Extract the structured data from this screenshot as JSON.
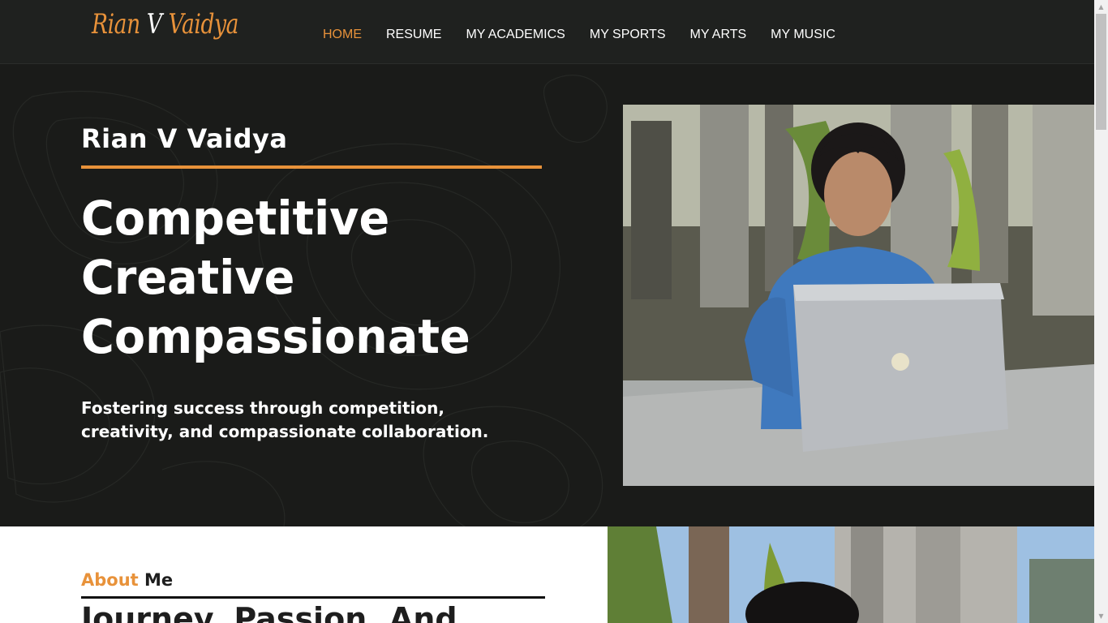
{
  "brand": {
    "logo_first": "Rian",
    "logo_middle": "V",
    "logo_last": "Vaidya",
    "accent_color": "#e8923a"
  },
  "nav": {
    "items": [
      {
        "label": "HOME",
        "active": true
      },
      {
        "label": "RESUME"
      },
      {
        "label": "MY ACADEMICS"
      },
      {
        "label": "MY SPORTS"
      },
      {
        "label": "MY ARTS"
      },
      {
        "label": "MY MUSIC"
      }
    ]
  },
  "hero": {
    "name": "Rian V Vaidya",
    "heading_lines": [
      "Competitive",
      "Creative",
      "Compassionate"
    ],
    "tagline": "Fostering success through competition, creativity, and compassionate collaboration.",
    "photo_icon": "portrait-with-laptop-photo"
  },
  "about": {
    "label_accent": "About",
    "label_rest": "Me",
    "heading": "Journey, Passion, And",
    "photo_icon": "portrait-outdoor-photo"
  }
}
